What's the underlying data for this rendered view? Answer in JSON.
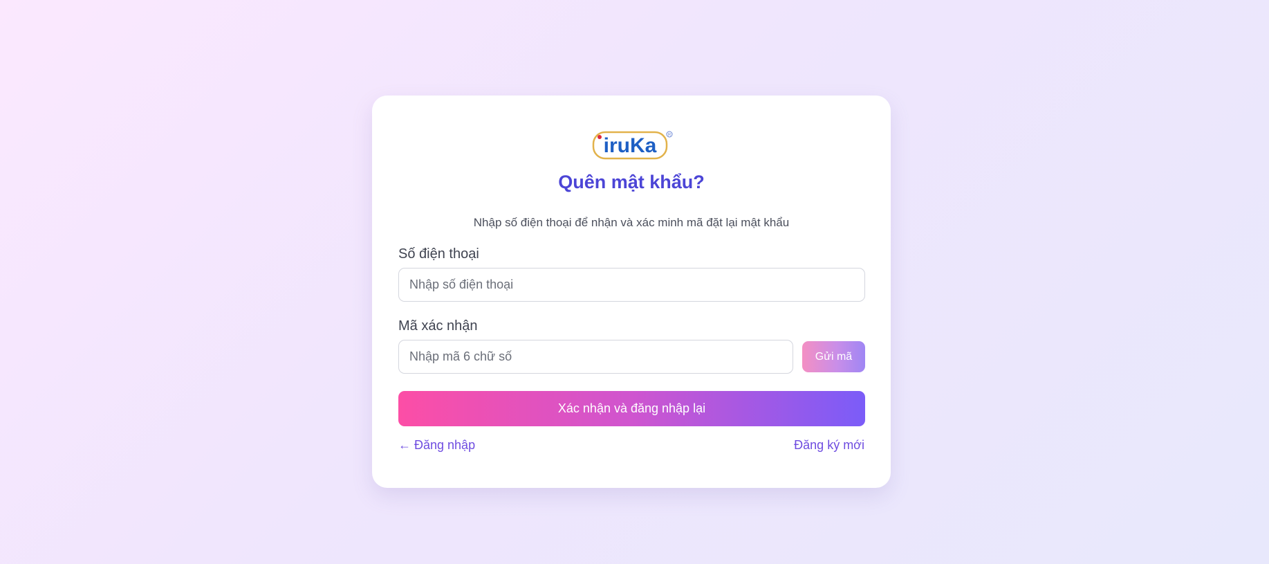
{
  "brand": {
    "logo_text": "iruKa",
    "logo_mark": "R"
  },
  "form": {
    "title": "Quên mật khẩu?",
    "subtitle": "Nhập số điện thoại để nhận và xác minh mã đặt lại mật khẩu",
    "phone": {
      "label": "Số điện thoại",
      "placeholder": "Nhập số điện thoại",
      "value": ""
    },
    "code": {
      "label": "Mã xác nhận",
      "placeholder": "Nhập mã 6 chữ số",
      "value": "",
      "send_label": "Gửi mã"
    },
    "submit_label": "Xác nhận và đăng nhập lại",
    "back_link": "← Đăng nhập",
    "register_link": "Đăng ký mới"
  },
  "colors": {
    "title": "#4c45d6",
    "link": "#6e4ce0",
    "gradient_start": "#fc4ea6",
    "gradient_end": "#7b5cf8",
    "logo_blue": "#1e5fc4",
    "logo_red": "#e0293a",
    "logo_outline": "#e2b24a"
  }
}
